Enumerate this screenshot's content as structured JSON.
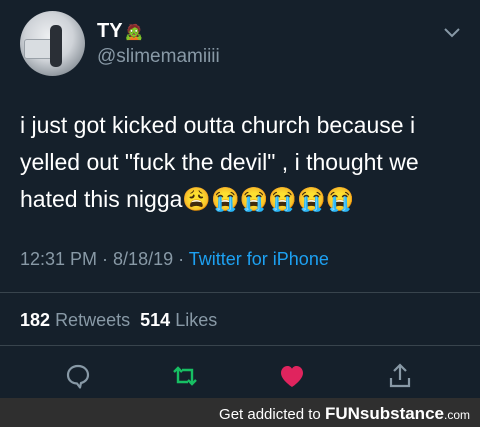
{
  "tweet": {
    "display_name": "TY",
    "name_emoji": "🧟",
    "handle": "@slimemamiiii",
    "text": "i just got kicked outta church because i yelled out \"fuck the devil\" , i thought we hated this nigga😩😭😭😭😭😭",
    "time": "12:31 PM · 8/18/19 · ",
    "source": "Twitter for iPhone",
    "retweets": "182",
    "retweets_label": "Retweets",
    "likes": "514",
    "likes_label": "Likes"
  },
  "icons": {
    "menu": "chevron-down-icon",
    "reply": "reply-icon",
    "retweet": "retweet-icon",
    "like": "heart-icon",
    "share": "share-icon"
  },
  "colors": {
    "background": "#15202b",
    "link": "#1da1f2",
    "retweet": "#17bf63",
    "like": "#e0245e"
  },
  "banner": {
    "prefix": "Get addicted to ",
    "brand_fun": "FUN",
    "brand_rest": "substance",
    "domain": ".com"
  }
}
